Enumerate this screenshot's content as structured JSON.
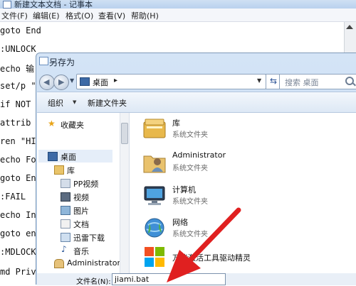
{
  "notepad": {
    "title": "新建文本文档 - 记事本",
    "menu": [
      "文件(F)",
      "编辑(E)",
      "格式(O)",
      "查看(V)",
      "帮助(H)"
    ],
    "lines": [
      "goto End",
      ":UNLOCK",
      "echo 输",
      "set/p \"",
      "if NOT",
      "attrib",
      "ren \"HI",
      "echo Fo",
      "goto En",
      ":FAIL",
      "echo In",
      "goto en",
      ":MDLOCK",
      "md Priv"
    ]
  },
  "dialog": {
    "title": "另存为",
    "address": {
      "current": "桌面"
    },
    "search_placeholder": "搜索 桌面",
    "toolbar": {
      "organize": "组织",
      "new_folder": "新建文件夹"
    },
    "nav": {
      "favorites": "收藏夹",
      "desktop": "桌面",
      "library": "库",
      "library_items": [
        "PP视频",
        "视频",
        "图片",
        "文档",
        "迅雷下载",
        "音乐"
      ],
      "admin": "Administrator"
    },
    "files": [
      {
        "name": "库",
        "type": "系统文件夹",
        "icon": "library-icon"
      },
      {
        "name": "Administrator",
        "type": "系统文件夹",
        "icon": "user-folder-icon"
      },
      {
        "name": "计算机",
        "type": "系统文件夹",
        "icon": "computer-icon"
      },
      {
        "name": "网络",
        "type": "系统文件夹",
        "icon": "network-icon"
      },
      {
        "name": "万能激活工具驱动精灵",
        "type": "",
        "icon": "app-shortcut-icon"
      }
    ],
    "filename_label": "文件名(N):",
    "filename_value": "jiami.bat"
  },
  "colors": {
    "annotation_arrow": "#e02020",
    "selection": "#e5eef9"
  }
}
